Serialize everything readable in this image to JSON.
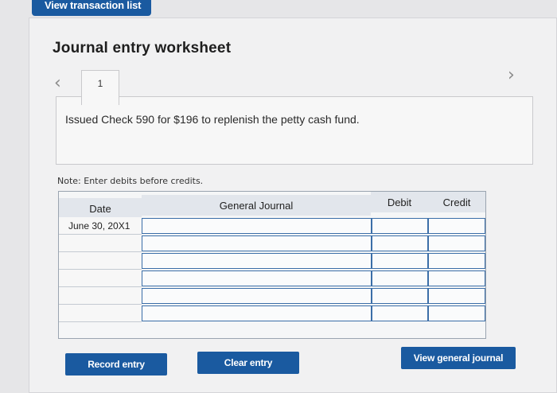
{
  "top_tab": {
    "label": "View transaction list"
  },
  "worksheet": {
    "title": "Journal entry worksheet",
    "page_tab": "1",
    "question": "Issued Check 590 for $196 to replenish the petty cash fund.",
    "note": "Note: Enter debits before credits."
  },
  "journal": {
    "headers": {
      "date": "Date",
      "account": "General Journal",
      "debit": "Debit",
      "credit": "Credit"
    },
    "rows": [
      {
        "date": "June 30, 20X1",
        "account": "",
        "debit": "",
        "credit": ""
      },
      {
        "date": "",
        "account": "",
        "debit": "",
        "credit": ""
      },
      {
        "date": "",
        "account": "",
        "debit": "",
        "credit": ""
      },
      {
        "date": "",
        "account": "",
        "debit": "",
        "credit": ""
      },
      {
        "date": "",
        "account": "",
        "debit": "",
        "credit": ""
      },
      {
        "date": "",
        "account": "",
        "debit": "",
        "credit": ""
      }
    ]
  },
  "buttons": {
    "record": "Record entry",
    "clear": "Clear entry",
    "view_journal": "View general journal"
  },
  "colors": {
    "primary_button": "#1a5aa0",
    "cell_border": "#3b6ea8"
  }
}
